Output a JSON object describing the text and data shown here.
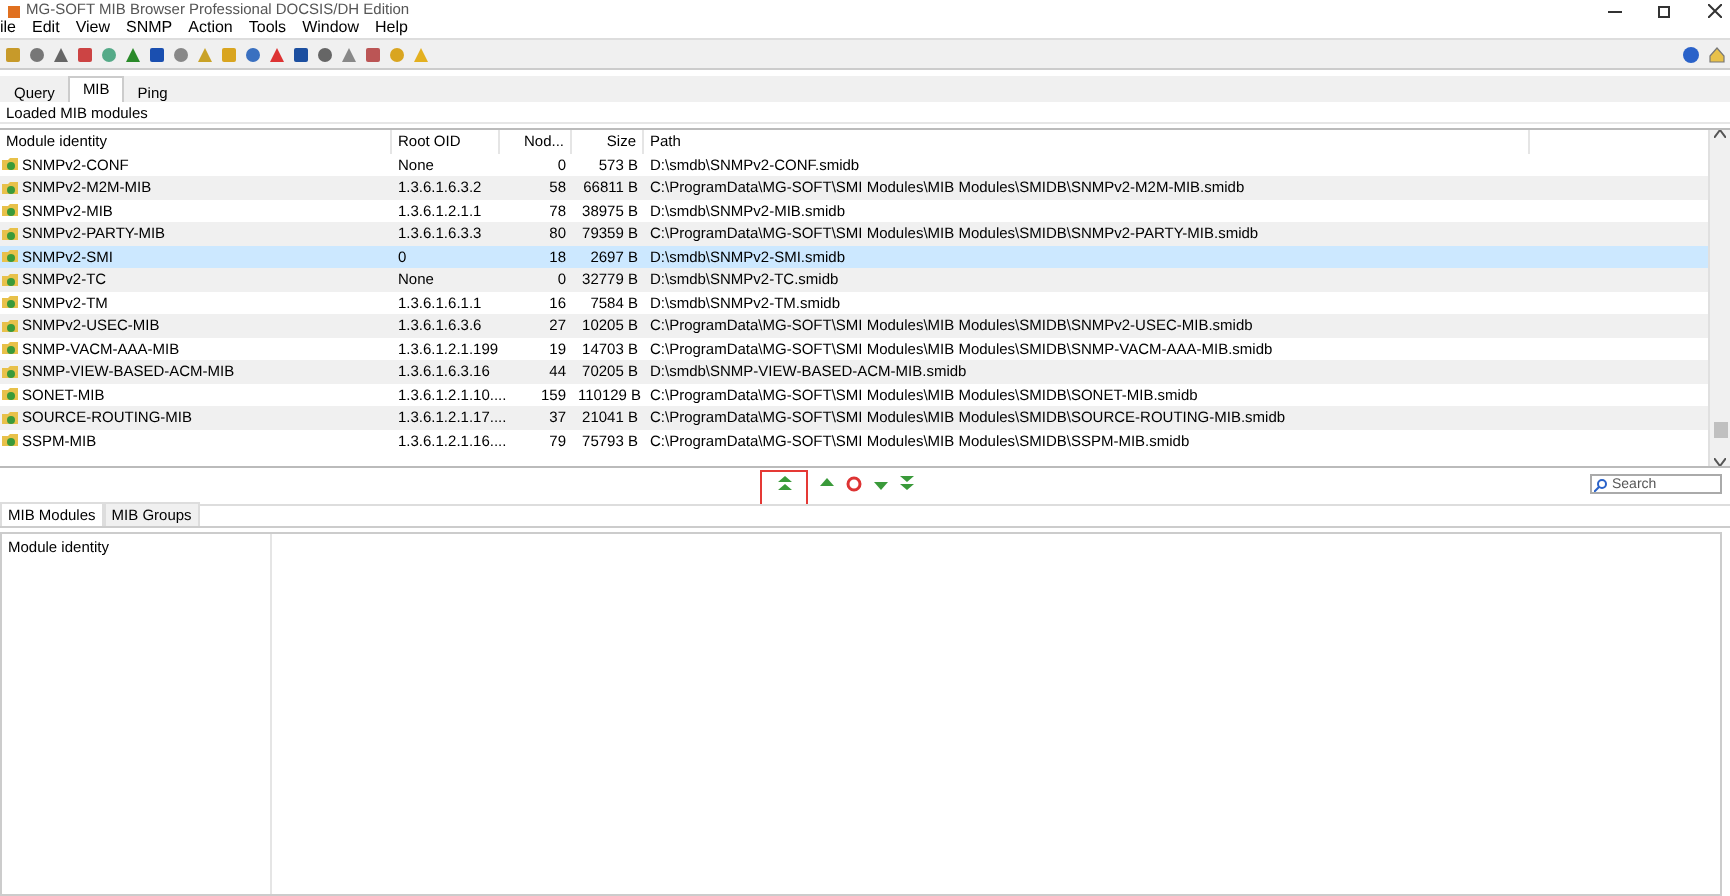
{
  "window": {
    "title": "MG-SOFT MIB Browser Professional DOCSIS/DH Edition"
  },
  "menu": [
    "ile",
    "Edit",
    "View",
    "SNMP",
    "Action",
    "Tools",
    "Window",
    "Help"
  ],
  "tabs": [
    {
      "label": "Query",
      "selected": false
    },
    {
      "label": "MIB",
      "selected": true
    },
    {
      "label": "Ping",
      "selected": false
    }
  ],
  "group_label": "Loaded MIB modules",
  "table": {
    "columns": [
      "Module identity",
      "Root OID",
      "Nod...",
      "Size",
      "Path"
    ],
    "rows": [
      {
        "cells": [
          "SNMPv2-CONF",
          "None",
          "0",
          "573 B",
          "D:\\smdb\\SNMPv2-CONF.smidb"
        ],
        "selected": false
      },
      {
        "cells": [
          "SNMPv2-M2M-MIB",
          "1.3.6.1.6.3.2",
          "58",
          "66811 B",
          "C:\\ProgramData\\MG-SOFT\\SMI Modules\\MIB Modules\\SMIDB\\SNMPv2-M2M-MIB.smidb"
        ],
        "selected": false
      },
      {
        "cells": [
          "SNMPv2-MIB",
          "1.3.6.1.2.1.1",
          "78",
          "38975 B",
          "D:\\smdb\\SNMPv2-MIB.smidb"
        ],
        "selected": false
      },
      {
        "cells": [
          "SNMPv2-PARTY-MIB",
          "1.3.6.1.6.3.3",
          "80",
          "79359 B",
          "C:\\ProgramData\\MG-SOFT\\SMI Modules\\MIB Modules\\SMIDB\\SNMPv2-PARTY-MIB.smidb"
        ],
        "selected": false
      },
      {
        "cells": [
          "SNMPv2-SMI",
          "0",
          "18",
          "2697 B",
          "D:\\smdb\\SNMPv2-SMI.smidb"
        ],
        "selected": true
      },
      {
        "cells": [
          "SNMPv2-TC",
          "None",
          "0",
          "32779 B",
          "D:\\smdb\\SNMPv2-TC.smidb"
        ],
        "selected": false
      },
      {
        "cells": [
          "SNMPv2-TM",
          "1.3.6.1.6.1.1",
          "16",
          "7584 B",
          "D:\\smdb\\SNMPv2-TM.smidb"
        ],
        "selected": false
      },
      {
        "cells": [
          "SNMPv2-USEC-MIB",
          "1.3.6.1.6.3.6",
          "27",
          "10205 B",
          "C:\\ProgramData\\MG-SOFT\\SMI Modules\\MIB Modules\\SMIDB\\SNMPv2-USEC-MIB.smidb"
        ],
        "selected": false
      },
      {
        "cells": [
          "SNMP-VACM-AAA-MIB",
          "1.3.6.1.2.1.199",
          "19",
          "14703 B",
          "C:\\ProgramData\\MG-SOFT\\SMI Modules\\MIB Modules\\SMIDB\\SNMP-VACM-AAA-MIB.smidb"
        ],
        "selected": false
      },
      {
        "cells": [
          "SNMP-VIEW-BASED-ACM-MIB",
          "1.3.6.1.6.3.16",
          "44",
          "70205 B",
          "D:\\smdb\\SNMP-VIEW-BASED-ACM-MIB.smidb"
        ],
        "selected": false
      },
      {
        "cells": [
          "SONET-MIB",
          "1.3.6.1.2.1.10....",
          "159",
          "110129 B",
          "C:\\ProgramData\\MG-SOFT\\SMI Modules\\MIB Modules\\SMIDB\\SONET-MIB.smidb"
        ],
        "selected": false
      },
      {
        "cells": [
          "SOURCE-ROUTING-MIB",
          "1.3.6.1.2.1.17....",
          "37",
          "21041 B",
          "C:\\ProgramData\\MG-SOFT\\SMI Modules\\MIB Modules\\SMIDB\\SOURCE-ROUTING-MIB.smidb"
        ],
        "selected": false
      },
      {
        "cells": [
          "SSPM-MIB",
          "1.3.6.1.2.1.16....",
          "79",
          "75793 B",
          "C:\\ProgramData\\MG-SOFT\\SMI Modules\\MIB Modules\\SMIDB\\SSPM-MIB.smidb"
        ],
        "selected": false
      }
    ]
  },
  "search": {
    "placeholder": "Search"
  },
  "lower_tabs": [
    {
      "label": "MIB Modules",
      "selected": true
    },
    {
      "label": "MIB Groups",
      "selected": false
    }
  ],
  "lower_table": {
    "columns": [
      "Module identity"
    ]
  }
}
